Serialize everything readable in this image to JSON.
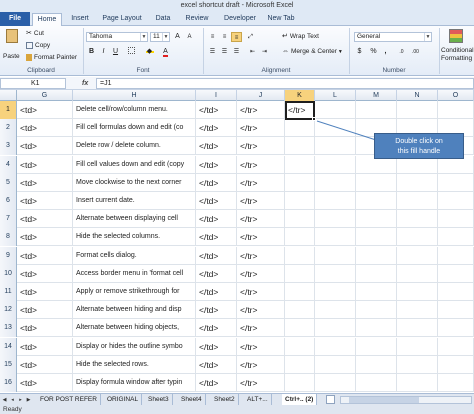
{
  "window": {
    "title": "excel shortcut draft - Microsoft Excel"
  },
  "tabs": [
    "File",
    "Home",
    "Insert",
    "Page Layout",
    "Data",
    "Review",
    "Developer",
    "New Tab"
  ],
  "ribbon": {
    "clipboard": {
      "paste": "Paste",
      "cut": "Cut",
      "copy": "Copy",
      "format_painter": "Format Painter",
      "label": "Clipboard"
    },
    "font": {
      "name": "Tahoma",
      "size": "11",
      "label": "Font"
    },
    "alignment": {
      "wrap_text": "Wrap Text",
      "merge_center": "Merge & Center",
      "label": "Alignment"
    },
    "number": {
      "format": "General",
      "currency": "$",
      "percent": "%",
      "comma": ",",
      "label": "Number"
    },
    "styles": {
      "conditional": "Conditional",
      "formatting": "Formatting"
    }
  },
  "formula_bar": {
    "name_box": "K1",
    "fx": "fx",
    "formula": "=J1"
  },
  "columns": [
    "G",
    "H",
    "I",
    "J",
    "K",
    "L",
    "M",
    "N",
    "O"
  ],
  "selected_column": "K",
  "rows": [
    {
      "num": "1",
      "g": "<td>",
      "h": "Delete cell/row/column menu.",
      "i": "</td>",
      "j": "</tr>",
      "k": "</tr>"
    },
    {
      "num": "2",
      "g": "<td>",
      "h": "Fill cell formulas down and edit (co",
      "i": "</td>",
      "j": "</tr>",
      "k": ""
    },
    {
      "num": "3",
      "g": "<td>",
      "h": "Delete row / delete column.",
      "i": "</td>",
      "j": "</tr>",
      "k": ""
    },
    {
      "num": "4",
      "g": "<td>",
      "h": "Fill cell values down and edit (copy",
      "i": "</td>",
      "j": "</tr>",
      "k": ""
    },
    {
      "num": "5",
      "g": "<td>",
      "h": "Move clockwise to the next corner",
      "i": "</td>",
      "j": "</tr>",
      "k": ""
    },
    {
      "num": "6",
      "g": "<td>",
      "h": "Insert current date.",
      "i": "</td>",
      "j": "</tr>",
      "k": ""
    },
    {
      "num": "7",
      "g": "<td>",
      "h": "Alternate between displaying cell",
      "i": "</td>",
      "j": "</tr>",
      "k": ""
    },
    {
      "num": "8",
      "g": "<td>",
      "h": "Hide the selected columns.",
      "i": "</td>",
      "j": "</tr>",
      "k": ""
    },
    {
      "num": "9",
      "g": "<td>",
      "h": "Format cells dialog.",
      "i": "</td>",
      "j": "</tr>",
      "k": ""
    },
    {
      "num": "10",
      "g": "<td>",
      "h": "Access border menu in 'format cell",
      "i": "</td>",
      "j": "</tr>",
      "k": ""
    },
    {
      "num": "11",
      "g": "<td>",
      "h": "Apply or remove strikethrough for",
      "i": "</td>",
      "j": "</tr>",
      "k": ""
    },
    {
      "num": "12",
      "g": "<td>",
      "h": "Alternate between hiding and disp",
      "i": "</td>",
      "j": "</tr>",
      "k": ""
    },
    {
      "num": "13",
      "g": "<td>",
      "h": "Alternate between hiding objects,",
      "i": "</td>",
      "j": "</tr>",
      "k": ""
    },
    {
      "num": "14",
      "g": "<td>",
      "h": "Display or hides the outline symbo",
      "i": "</td>",
      "j": "</tr>",
      "k": ""
    },
    {
      "num": "15",
      "g": "<td>",
      "h": "Hide the selected rows.",
      "i": "</td>",
      "j": "</tr>",
      "k": ""
    },
    {
      "num": "16",
      "g": "<td>",
      "h": "Display formula window after typin",
      "i": "</td>",
      "j": "</tr>",
      "k": ""
    }
  ],
  "callout": {
    "line1": "Double click on",
    "line2": "this fill handle"
  },
  "sheet_tabs": [
    "FOR POST REFER",
    "ORIGINAL",
    "Sheet3",
    "Sheet4",
    "Sheet2",
    "ALT+...",
    "Ctrl+.. (2)"
  ],
  "active_sheet": "Ctrl+.. (2)",
  "status": "Ready",
  "colors": {
    "file_tab": "#2a5fa8",
    "callout": "#4f81bd",
    "selected_header": "#f7d27d"
  }
}
